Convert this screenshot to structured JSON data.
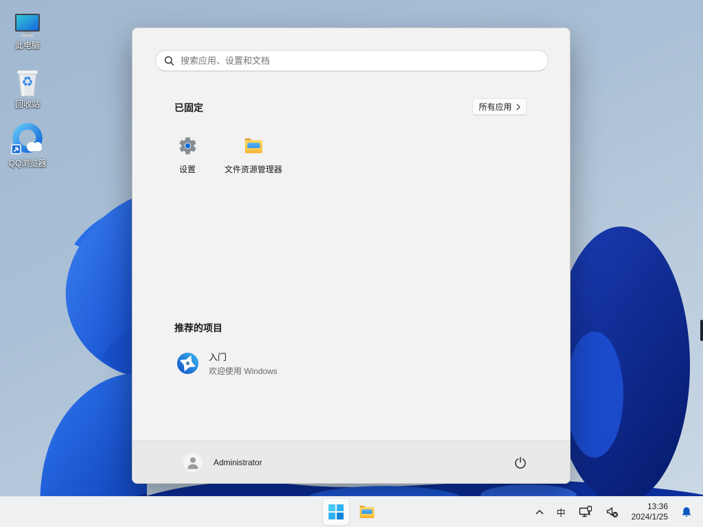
{
  "desktop": {
    "icons": [
      {
        "label": "此电脑",
        "icon": "this-pc-icon"
      },
      {
        "label": "回收站",
        "icon": "recycle-bin-icon"
      },
      {
        "label": "QQ浏览器",
        "icon": "qq-browser-icon"
      }
    ]
  },
  "start_menu": {
    "search": {
      "placeholder": "搜索应用、设置和文档",
      "icon": "search-icon"
    },
    "pinned": {
      "header": "已固定",
      "all_apps_label": "所有应用",
      "apps": [
        {
          "label": "设置",
          "icon": "settings-gear-icon"
        },
        {
          "label": "文件资源管理器",
          "icon": "file-explorer-icon"
        }
      ]
    },
    "recommended": {
      "header": "推荐的项目",
      "items": [
        {
          "title": "入门",
          "subtitle": "欢迎使用 Windows",
          "icon": "get-started-icon"
        }
      ]
    },
    "footer": {
      "username": "Administrator",
      "power_icon": "power-icon"
    }
  },
  "taskbar": {
    "tray": {
      "ime_label": "中",
      "time": "13:36",
      "date": "2024/1/25"
    }
  },
  "colors": {
    "accent_blue": "#0f6cd6",
    "bell_blue": "#0b57c2",
    "bloom_bright": "#2a6ae8",
    "bloom_dark": "#0a2f9e",
    "menu_bg": "#f2f2f2",
    "taskbar_bg": "#eef0f1"
  }
}
